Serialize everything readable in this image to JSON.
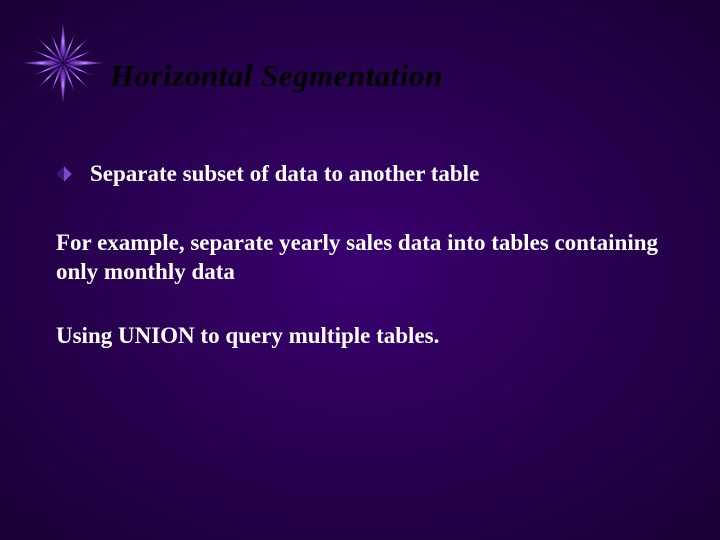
{
  "slide": {
    "title": "Horizontal Segmentation",
    "bullet1": "Separate subset of data to another table",
    "para1": "For example, separate yearly sales data into tables containing only monthly data",
    "para2": "Using UNION to query multiple tables."
  },
  "colors": {
    "background": "#2a0050",
    "title": "#000000",
    "body": "#ffffff",
    "bullet": "#5a2aa0"
  }
}
